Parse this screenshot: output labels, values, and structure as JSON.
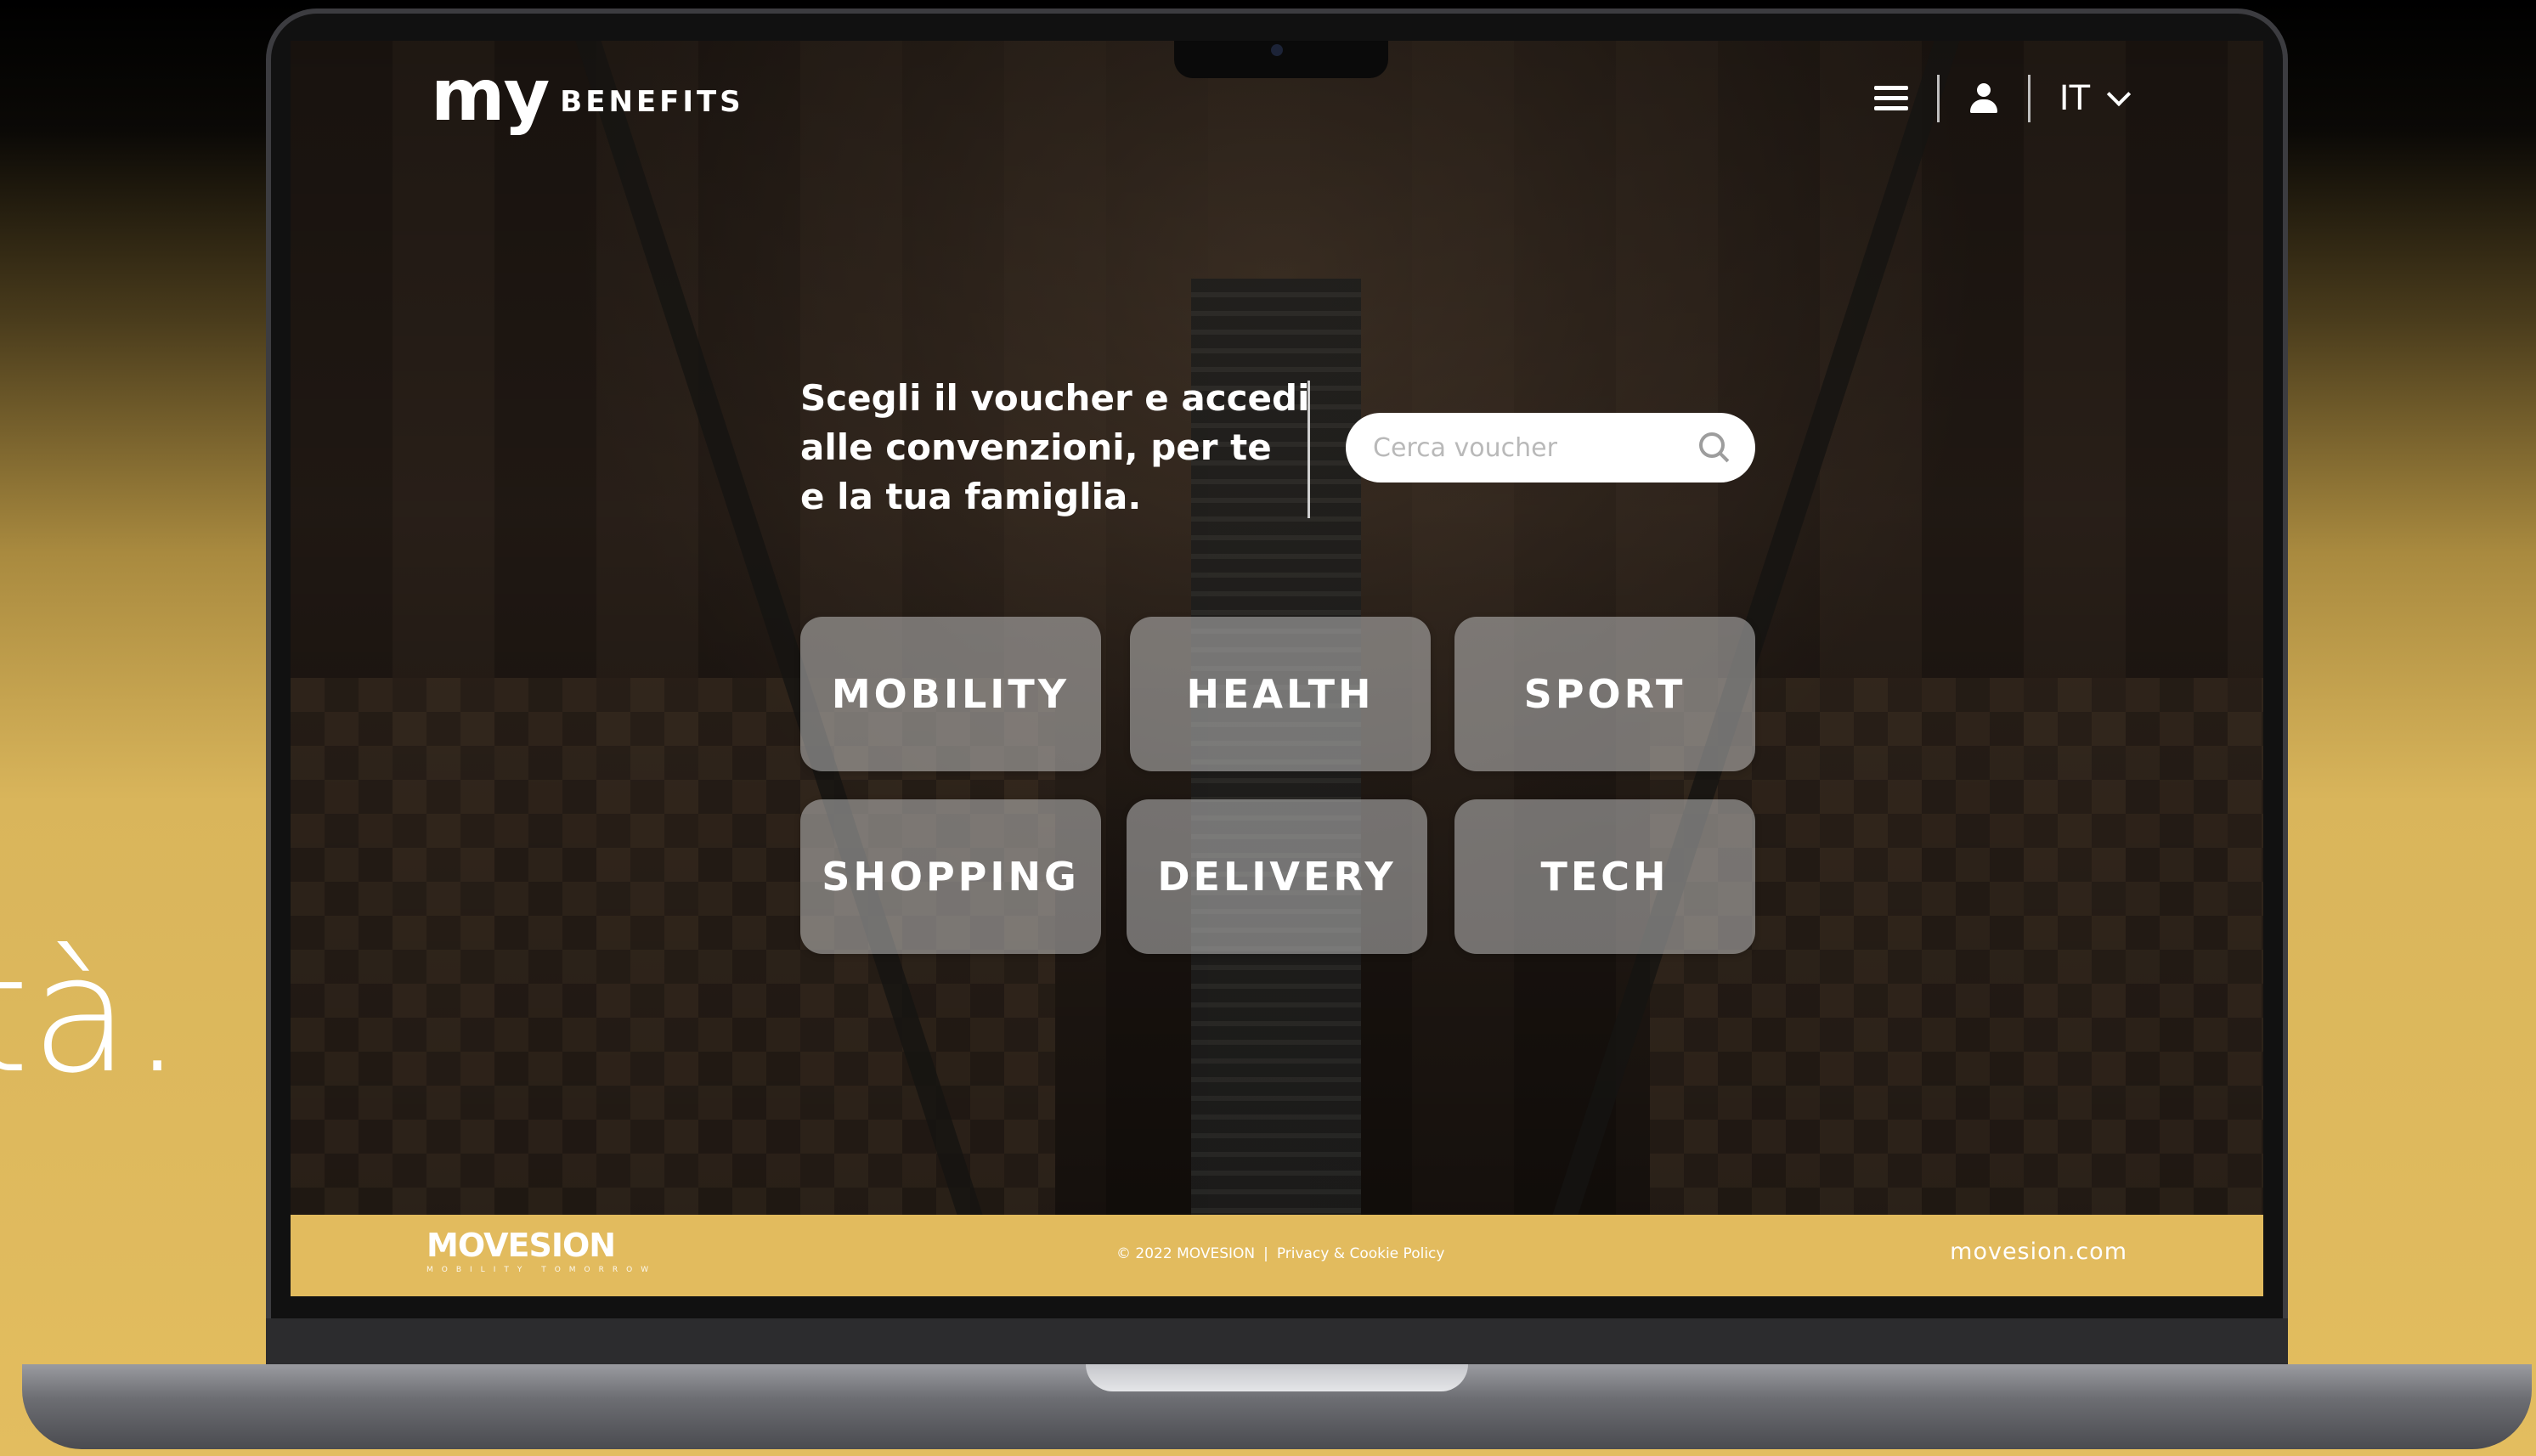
{
  "background_slogan": "tà.",
  "header": {
    "logo_my": "my",
    "logo_benefits": "BENEFITS",
    "language": "IT"
  },
  "hero": {
    "lines": [
      "Scegli il voucher e accedi",
      "alle convenzioni, per te",
      "e la tua famiglia."
    ]
  },
  "search": {
    "placeholder": "Cerca voucher",
    "value": ""
  },
  "categories": [
    {
      "label": "MOBILITY"
    },
    {
      "label": "HEALTH"
    },
    {
      "label": "SPORT"
    },
    {
      "label": "SHOPPING"
    },
    {
      "label": "DELIVERY"
    },
    {
      "label": "TECH"
    }
  ],
  "footer": {
    "logo_name": "MOVESION",
    "logo_tagline": "MOBILITY TOMORROW",
    "copyright": "© 2022 MOVESION",
    "separator": "|",
    "policy_link": "Privacy & Cookie Policy",
    "website": "movesion.com"
  },
  "icons": {
    "menu": "hamburger-menu-icon",
    "user": "user-icon",
    "language_chevron": "chevron-down-icon",
    "search": "search-icon"
  },
  "colors": {
    "accent_gold": "#e2bb5e",
    "tile_bg": "rgba(190,190,190,0.55)",
    "text_white": "#ffffff"
  }
}
